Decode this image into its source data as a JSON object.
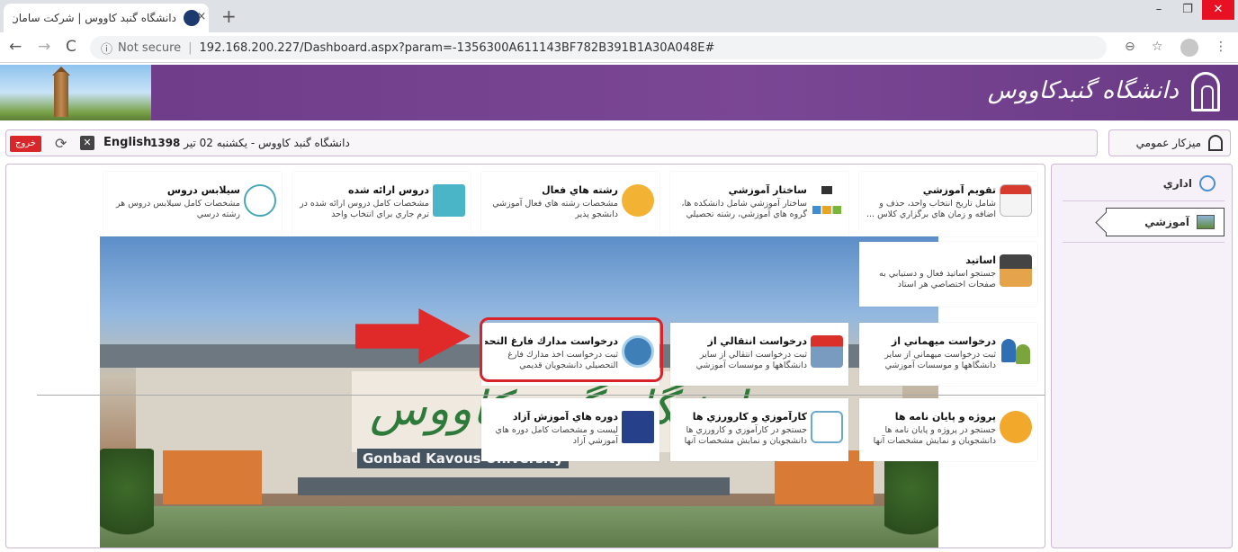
{
  "browser": {
    "tab_title": "دانشگاه گنبد کاووس | شرکت سامان",
    "tab_close": "×",
    "new_tab": "+",
    "not_secure": "Not secure",
    "url": "192.168.200.227/Dashboard.aspx?param=-1356300A611143BF782B391B1A30A048E#",
    "controls": {
      "minimize": "–",
      "maximize": "❐",
      "close": "✕"
    }
  },
  "header": {
    "logo_text": "دانشگاه گنبدکاووس"
  },
  "toolbar": {
    "logout": "خروج",
    "language": "English",
    "user_info_prefix": "دانشگاه گنبد کاووس - یکشنبه 02 تیر ",
    "year": "1398",
    "desk_label": "میزکار عمومي"
  },
  "sidebar": {
    "items": [
      {
        "label": "اداري"
      },
      {
        "label": "آموزشي"
      }
    ]
  },
  "hero": {
    "name_text": "دانشگاه گنبد کاووس",
    "english_text": "Gonbad Kavous University"
  },
  "cards": {
    "taqvim": {
      "title": "تقويم آموزشي",
      "desc": "شامل تاريخ انتخاب واحد، حذف و اضافه و زمان هاي برگزاري كلاس ..."
    },
    "sakhtar": {
      "title": "ساختار آموزشي",
      "desc": "ساختار آموزشي شامل دانشكده ها، گروه هاي آموزشي، رشته تحصيلي"
    },
    "reshte": {
      "title": "رشته هاي فعال",
      "desc": "مشخصات رشته هاي فعال آموزشي دانشجو پذير"
    },
    "doros": {
      "title": "دروس ارائه شده",
      "desc": "مشخصات كامل دروس ارائه شده در ترم جاري براي انتخاب واحد"
    },
    "silabus": {
      "title": "سيلابس دروس",
      "desc": "مشخصات كامل سيلابس دروس هر رشته درسي"
    },
    "asatid": {
      "title": "اساتيد",
      "desc": "جستجو اساتيد فعال و دستيابي به صفحات اختصاصي هر استاد"
    },
    "mehman": {
      "title": "درخواست ميهماني از",
      "desc": "ثبت درخواست ميهماني از ساير دانشگاهها و موسسات آموزشي"
    },
    "enteghali": {
      "title": "درخواست انتقالي از",
      "desc": "ثبت درخواست انتقالي از ساير دانشگاهها و موسسات آموزشي"
    },
    "madarek": {
      "title": "درخواست مدارك فارغ التحصيلي",
      "desc": "ثبت درخواست اخذ مدارك فارغ التحصيلي دانشجويان قديمي"
    },
    "proje": {
      "title": "پروژه و پايان نامه ها",
      "desc": "جستجو در پروژه و پايان نامه ها دانشجويان و نمايش مشخصات آنها"
    },
    "karamouzi": {
      "title": "كارآموزي و كارورزي ها",
      "desc": "جستجو در كارآموزي و كارورزي ها دانشجويان و نمايش مشخصات آنها"
    },
    "doreh": {
      "title": "دوره هاي آموزش آزاد",
      "desc": "ليست و مشخصات كامل دوره هاي آموزشي آزاد"
    }
  }
}
